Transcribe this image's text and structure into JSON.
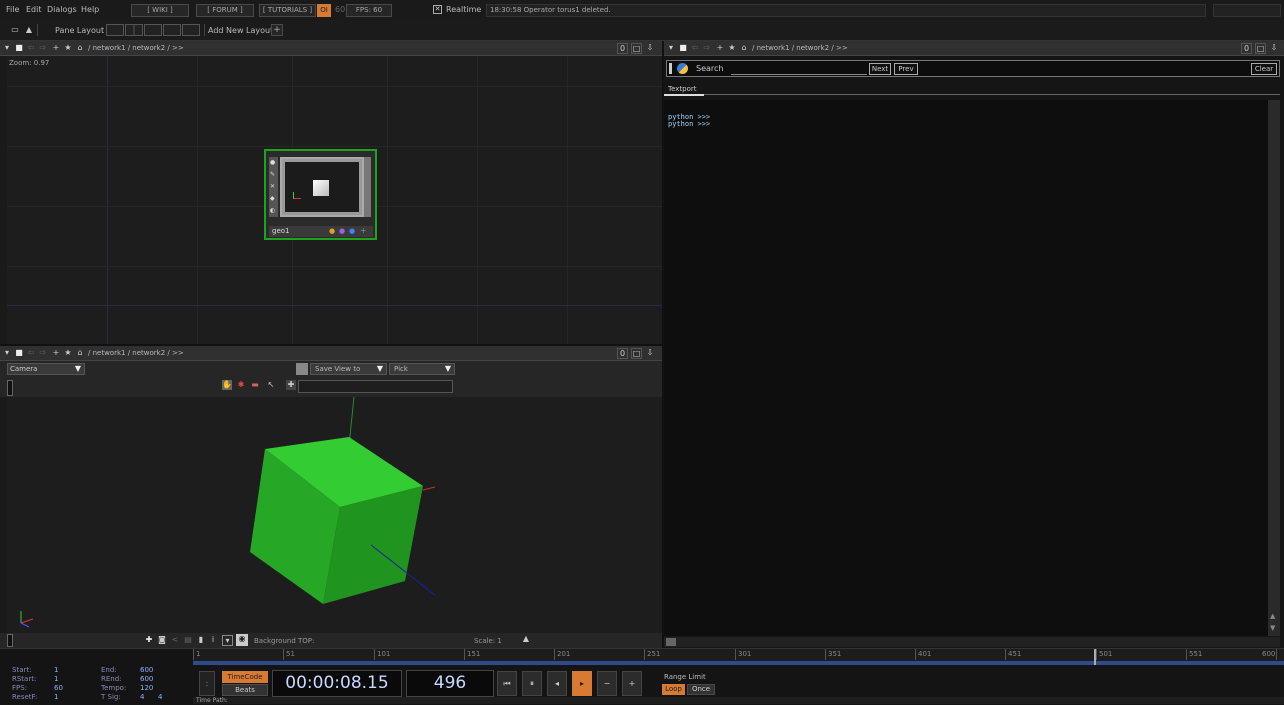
{
  "menu": {
    "file": "File",
    "edit": "Edit",
    "dialogs": "Dialogs",
    "help": "Help",
    "wiki": "[ WIKI ]",
    "forum": "[ FORUM ]",
    "tutorials": "[ TUTORIALS ]",
    "oi": "OI",
    "fps_small": "60",
    "fps": "FPS: 60",
    "realtime": "Realtime",
    "status": "18:30:58 Operator torus1 deleted."
  },
  "toolbar": {
    "pane_layout": "Pane Layout",
    "add_new_layout": "Add New Layout"
  },
  "network_pane": {
    "breadcrumb": "/ network1 / network2 / >>",
    "zoom": "Zoom: 0.97",
    "node_name": "geo1"
  },
  "viewer_pane": {
    "breadcrumb": "/ network1 / network2 / >>",
    "camera": "Camera",
    "save_view": "Save View to",
    "pick": "Pick",
    "background_top": "Background TOP:",
    "scale": "Scale: 1"
  },
  "textport_pane": {
    "breadcrumb": "/ network1 / network2 / >>",
    "search_label": "Search",
    "next": "Next",
    "prev": "Prev",
    "clear": "Clear",
    "tab": "Textport",
    "lines": [
      "python >>>",
      "python >>>"
    ]
  },
  "timeline": {
    "ticks": [
      "1",
      "51",
      "101",
      "151",
      "201",
      "251",
      "301",
      "351",
      "401",
      "451",
      "501",
      "551",
      "600"
    ],
    "stats": {
      "start_label": "Start:",
      "start": "1",
      "end_label": "End:",
      "end": "600",
      "rstart_label": "RStart:",
      "rstart": "1",
      "rend_label": "REnd:",
      "rend": "600",
      "fps_label": "FPS:",
      "fps": "60",
      "tempo_label": "Tempo:",
      "tempo": "120",
      "resetf_label": "ResetF:",
      "resetf": "1",
      "tsig_label": "T Sig:",
      "tsig_a": "4",
      "tsig_b": "4"
    },
    "timecode_btn": "TimeCode",
    "beats_btn": "Beats",
    "timecode": "00:00:08.15",
    "frame": "496",
    "range_limit": "Range Limit",
    "loop": "Loop",
    "once": "Once",
    "time_path": "Time Path:"
  },
  "colors": {
    "accent": "#d87a32",
    "node_border": "#1fa31f",
    "cube": "#2bc22b"
  }
}
